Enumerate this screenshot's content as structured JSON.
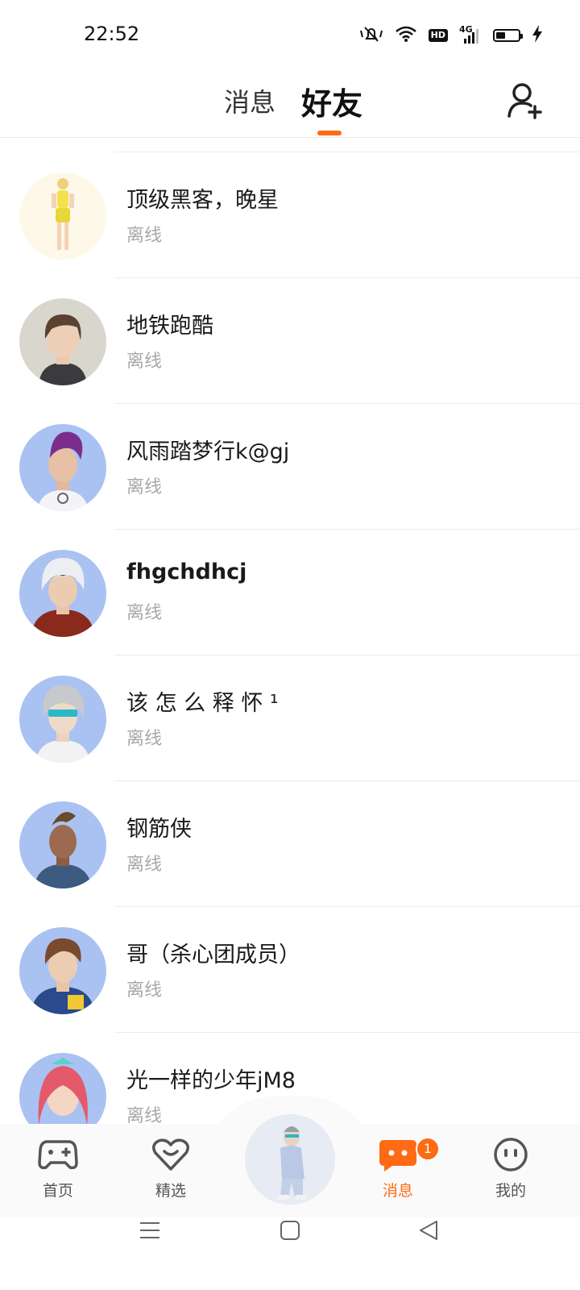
{
  "status_bar": {
    "time": "22:52",
    "icons": [
      "mute-icon",
      "wifi-icon",
      "hd-icon",
      "signal-4g-icon",
      "battery-icon",
      "charging-icon"
    ],
    "hd_label": "HD",
    "network_label": "4G",
    "battery_level": 0.38
  },
  "top_tabs": {
    "messages_label": "消息",
    "friends_label": "好友",
    "active": "friends"
  },
  "friends": [
    {
      "name": "顶级黑客，晚星",
      "status": "离线"
    },
    {
      "name": "地铁跑酷",
      "status": "离线"
    },
    {
      "name": "风雨踏梦行k@gj",
      "status": "离线"
    },
    {
      "name": "fhgchdhcj",
      "status": "离线"
    },
    {
      "name": "该 怎 么 释 怀 ¹",
      "status": "离线"
    },
    {
      "name": "钢筋侠",
      "status": "离线"
    },
    {
      "name": "哥（杀心团成员）",
      "status": "离线"
    },
    {
      "name": "光一样的少年jM8",
      "status": "离线"
    }
  ],
  "bottom_nav": {
    "home_label": "首页",
    "featured_label": "精选",
    "messages_label": "消息",
    "messages_badge": "1",
    "me_label": "我的",
    "active": "messages"
  },
  "colors": {
    "accent": "#ff6a14",
    "status_gray": "#a8a8a8",
    "divider": "#ececec"
  }
}
